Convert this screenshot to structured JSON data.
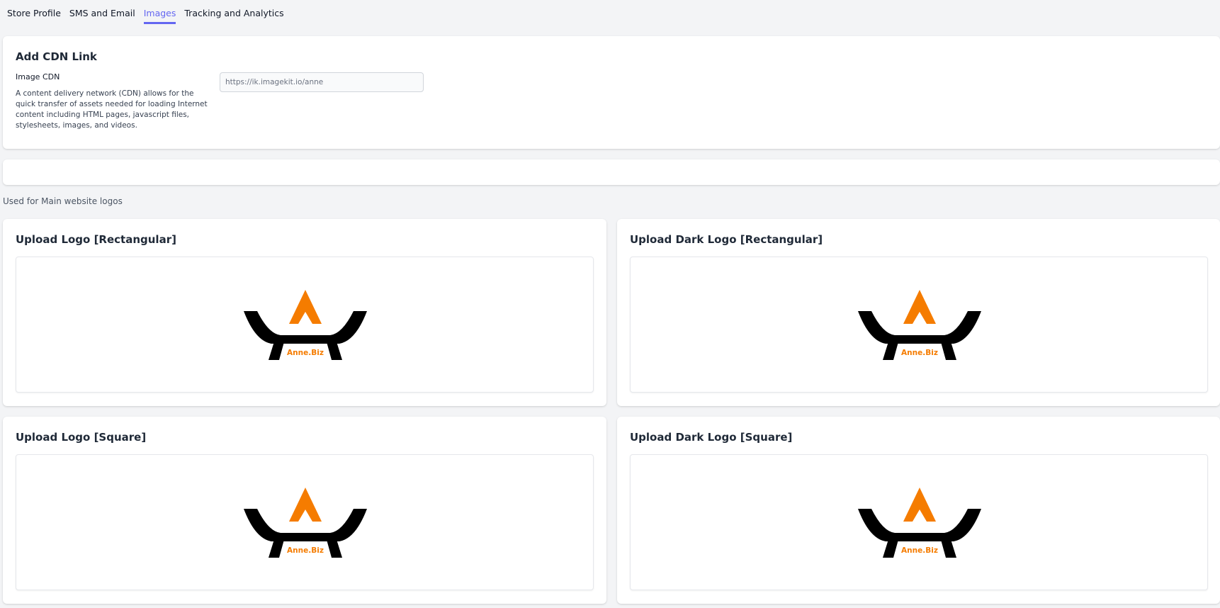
{
  "tabs": [
    {
      "label": "Store Profile",
      "active": false
    },
    {
      "label": "SMS and Email",
      "active": false
    },
    {
      "label": "Images",
      "active": true
    },
    {
      "label": "Tracking and Analytics",
      "active": false
    }
  ],
  "cdn": {
    "title": "Add CDN Link",
    "label": "Image CDN",
    "description": "A content delivery network (CDN) allows for the quick transfer of assets needed for loading Internet content including HTML pages, javascript files, stylesheets, images, and videos.",
    "input_value": "",
    "input_placeholder": "https://ik.imagekit.io/anne"
  },
  "section_note": "Used for Main website logos",
  "logo_cards": [
    {
      "title": "Upload Logo [Rectangular]",
      "logo_text": "Anne.Biz"
    },
    {
      "title": "Upload Dark Logo [Rectangular]",
      "logo_text": "Anne.Biz"
    },
    {
      "title": "Upload Logo [Square]",
      "logo_text": "Anne.Biz"
    },
    {
      "title": "Upload Dark Logo [Square]",
      "logo_text": "Anne.Biz"
    }
  ],
  "colors": {
    "accent": "#6366f1",
    "logo_orange": "#f57c00",
    "logo_black": "#000000",
    "page_bg": "#f3f4f6"
  }
}
